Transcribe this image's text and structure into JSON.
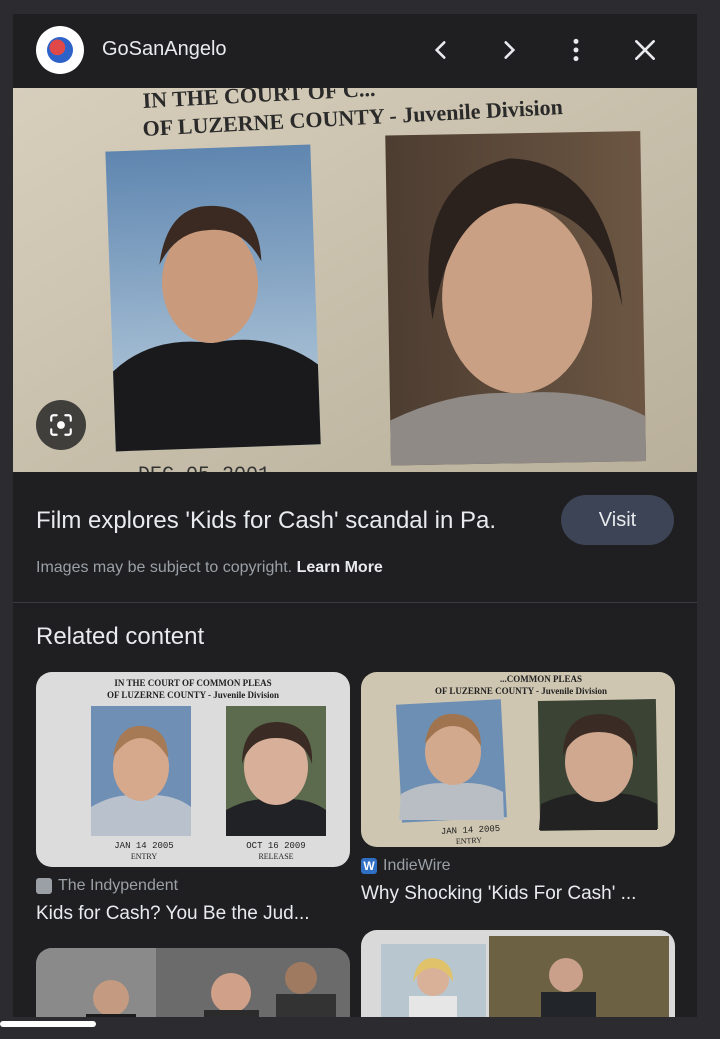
{
  "header": {
    "site_name": "GoSanAngelo",
    "icons": [
      "back-icon",
      "forward-icon",
      "more-vert-icon",
      "close-icon"
    ]
  },
  "hero": {
    "caption_line1": "IN THE COURT OF C...",
    "caption_line2": "OF LUZERNE COUNTY - Juvenile Division",
    "date_partial": "DEC 05 2001"
  },
  "result": {
    "title": "Film explores 'Kids for Cash' scandal in Pa.",
    "visit_label": "Visit",
    "copyright_text": "Images may be subject to copyright.",
    "learn_more": "Learn More"
  },
  "related": {
    "heading": "Related content",
    "items": [
      {
        "source": "The Indypendent",
        "title": "Kids for Cash? You Be the Jud...",
        "img_line1": "IN THE COURT OF COMMON PLEAS",
        "img_line2": "OF LUZERNE COUNTY - Juvenile Division",
        "entry_date": "JAN 14 2005",
        "entry_label": "ENTRY",
        "release_date": "OCT 16 2009",
        "release_label": "RELEASE"
      },
      {
        "source": "IndieWire",
        "title": "Why Shocking 'Kids For Cash' ...",
        "img_line1": "...COMMON PLEAS",
        "img_line2": "OF LUZERNE COUNTY - Juvenile Division",
        "entry_date": "JAN 14 2005",
        "entry_label": "ENTRY"
      }
    ]
  },
  "colors": {
    "background": "#1f1f21",
    "visit_button": "#3c4455",
    "text_primary": "#e8eaed",
    "text_secondary": "#9aa0a6"
  }
}
